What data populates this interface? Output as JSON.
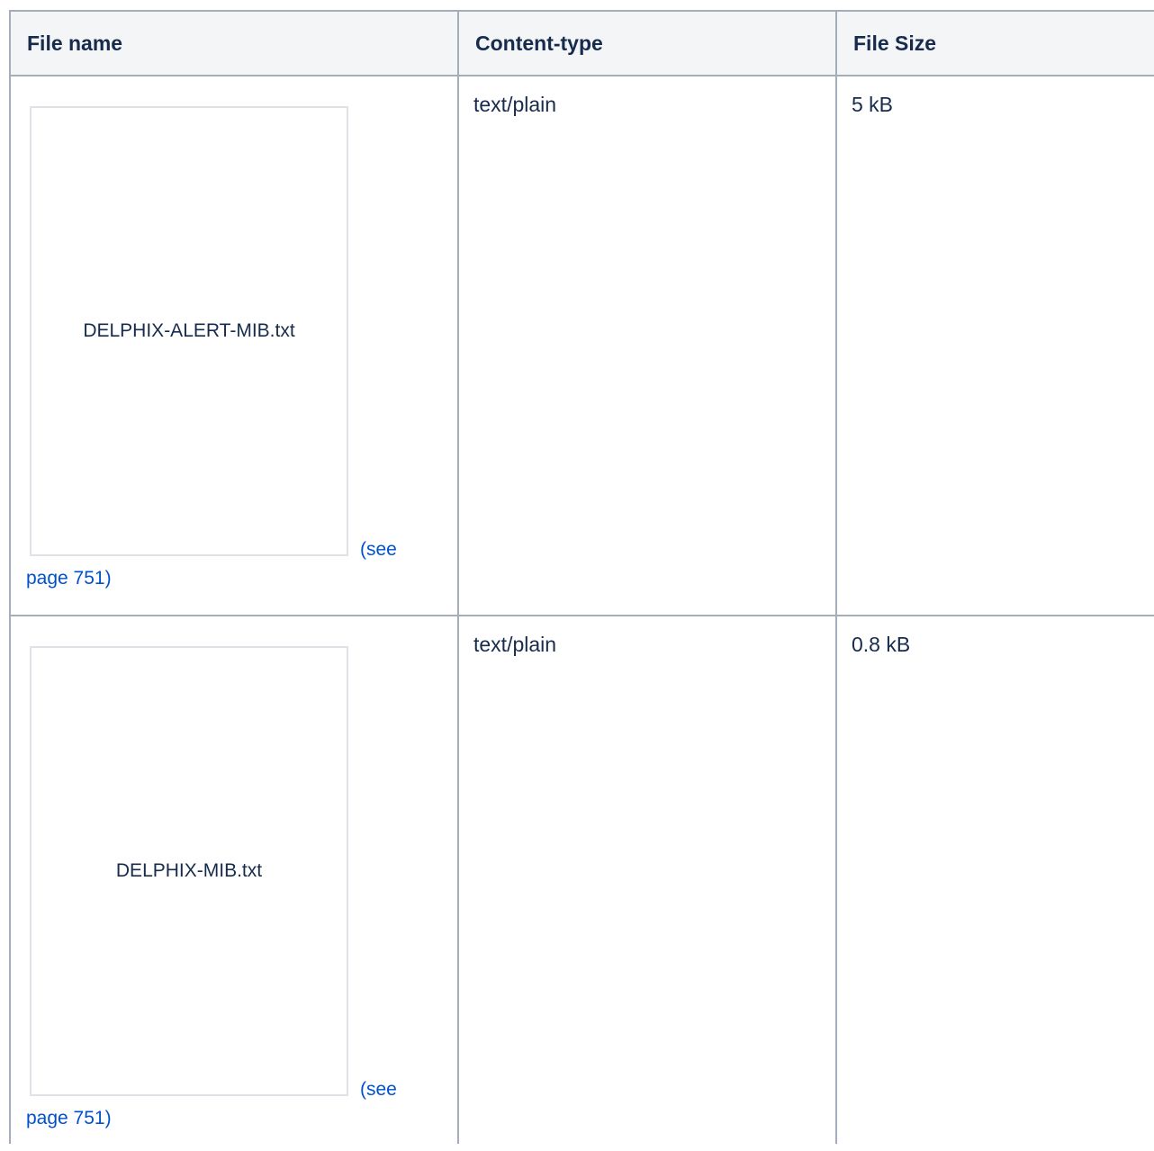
{
  "table": {
    "headers": {
      "file_name": "File name",
      "content_type": "Content-type",
      "file_size": "File Size"
    },
    "rows": [
      {
        "file_name": "DELPHIX-ALERT-MIB.txt",
        "link_part1": "(see",
        "link_part2": "page 751)",
        "content_type": "text/plain",
        "file_size": "5 kB"
      },
      {
        "file_name": "DELPHIX-MIB.txt",
        "link_part1": "(see",
        "link_part2": "page 751)",
        "content_type": "text/plain",
        "file_size": "0.8 kB"
      }
    ]
  },
  "colors": {
    "link": "#0052cc",
    "text": "#172b4d",
    "border": "#a5adba",
    "header_bg": "#f4f5f7"
  }
}
